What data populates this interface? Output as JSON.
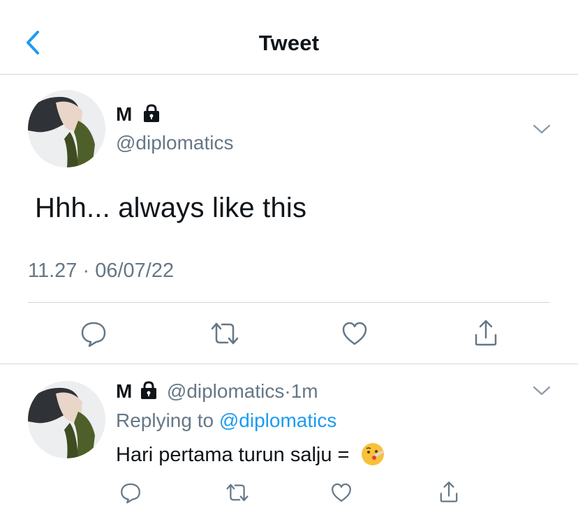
{
  "header": {
    "title": "Tweet",
    "back_icon": "chevron-left-icon"
  },
  "tweet": {
    "author_name": "M",
    "handle": "@diplomatics",
    "text": "Hhh... always like this",
    "timestamp": "11.27 · 06/07/22",
    "icons": [
      "lock-icon",
      "chevron-down-icon",
      "reply-icon",
      "retweet-icon",
      "like-icon",
      "share-icon"
    ]
  },
  "reply": {
    "author_name": "M",
    "handle": "@diplomatics",
    "dot": "·",
    "time": "1m",
    "replying_prefix": "Replying to",
    "replying_to": "@diplomatics",
    "text": "Hari pertama turun salju =",
    "emoji": "face-with-thermometer"
  },
  "colors": {
    "accent": "#1d9bf0",
    "secondary_text": "#657786",
    "divider": "#d3d7db"
  }
}
